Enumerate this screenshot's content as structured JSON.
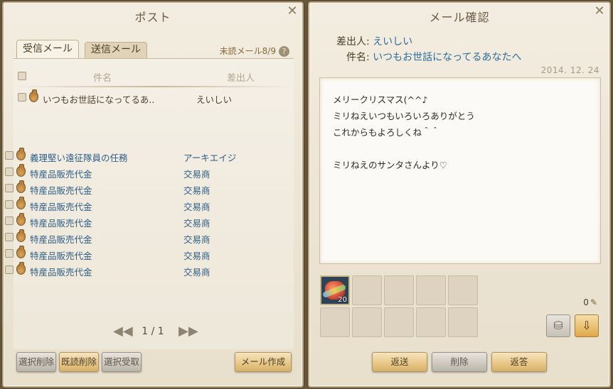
{
  "post": {
    "title": "ポスト",
    "close_icon": "✕",
    "tabs": [
      {
        "label": "受信メール",
        "active": true
      },
      {
        "label": "送信メール",
        "active": false
      }
    ],
    "unread_text": "未読メール8/9",
    "help_icon": "?",
    "columns": {
      "subject": "件名",
      "sender": "差出人"
    },
    "rows": [
      {
        "subject": "いつもお世話になってるあ..",
        "sender": "えいしい",
        "read": true
      },
      {
        "subject": "義理堅い遠征隊員の任務",
        "sender": "アーキエイジ",
        "read": false
      },
      {
        "subject": "特産品販売代金",
        "sender": "交易商",
        "read": false
      },
      {
        "subject": "特産品販売代金",
        "sender": "交易商",
        "read": false
      },
      {
        "subject": "特産品販売代金",
        "sender": "交易商",
        "read": false
      },
      {
        "subject": "特産品販売代金",
        "sender": "交易商",
        "read": false
      },
      {
        "subject": "特産品販売代金",
        "sender": "交易商",
        "read": false
      },
      {
        "subject": "特産品販売代金",
        "sender": "交易商",
        "read": false
      },
      {
        "subject": "特産品販売代金",
        "sender": "交易商",
        "read": false
      }
    ],
    "pager": {
      "text": "1 / 1",
      "prev_icon": "◀◀",
      "next_icon": "▶▶"
    },
    "buttons": {
      "delete_selected": "選択削除",
      "delete_read": "既読削除",
      "receive_selected": "選択受取",
      "compose": "メール作成"
    }
  },
  "mail": {
    "title": "メール確認",
    "close_icon": "✕",
    "sender_label": "差出人:",
    "sender": "えいしい",
    "subject_label": "件名:",
    "subject": "いつもお世話になってるあなたへ",
    "date": "2014. 12. 24",
    "body_lines": [
      "メリークリスマス(^^♪",
      "ミリねえいつもいろいろありがとう",
      "これからもよろしくね＾＾",
      "",
      "ミリねえのサンタさんより♡"
    ],
    "attachment": {
      "count": "20"
    },
    "gold": "0",
    "quill_icon": "✎",
    "take_money_icon": "⛁",
    "take_all_icon": "⇩",
    "buttons": {
      "reply": "返送",
      "delete": "削除",
      "answer": "返答"
    }
  }
}
